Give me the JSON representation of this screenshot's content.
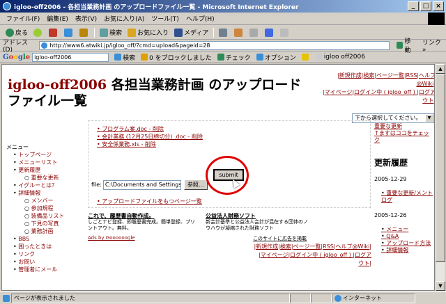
{
  "window": {
    "title": "igloo-off2006 - 各担当業務計画 のアップロードファイル一覧 - Microsoft Internet Explorer",
    "minimize": "_",
    "maximize": "□",
    "close": "×"
  },
  "menubar": {
    "items": [
      "ファイル(F)",
      "編集(E)",
      "表示(V)",
      "お気に入り(A)",
      "ツール(T)",
      "ヘルプ(H)"
    ]
  },
  "toolbar": {
    "back": "戻る",
    "search": "検索",
    "favorites": "お気に入り",
    "media": "メディア"
  },
  "addressbar": {
    "label": "アドレス(D)",
    "url": "http://www6.atwiki.jp/igloo_off/?cmd=upload&pageid=28",
    "go": "移動",
    "links": "リンク »"
  },
  "googlebar": {
    "logo": "Google",
    "query": "igloo-off2006",
    "search_btn": "検索",
    "blocked": "0 をブロックしました",
    "check": "チェック",
    "options": "オプション",
    "tab": "igloo off2006"
  },
  "page": {
    "brand": "igloo-off2006",
    "title_rest": " 各担当業務計画 のアップロードファイル一覧",
    "topnav_line1": "|新規作成|検索|ページ一覧|RSS|ヘルプ@Wiki|",
    "topnav_line2": "|マイページ|ログイン中 ( igloo_off ) |ログアウト|",
    "dropdown": "下から選択してください。",
    "left_menu": {
      "header": "メニュー",
      "items": [
        {
          "level": 1,
          "label": "トップページ"
        },
        {
          "level": 1,
          "label": "メニューリスト"
        },
        {
          "level": 1,
          "label": "更新履歴"
        },
        {
          "level": 2,
          "label": "重要な更新"
        },
        {
          "level": 1,
          "label": "イグルーとは？"
        },
        {
          "level": 1,
          "label": "詳細情報"
        },
        {
          "level": 2,
          "label": "メンバー"
        },
        {
          "level": 2,
          "label": "参加規程"
        },
        {
          "level": 2,
          "label": "装備品リスト"
        },
        {
          "level": 2,
          "label": "下見の写真"
        },
        {
          "level": 2,
          "label": "業務計画"
        },
        {
          "level": 1,
          "label": "BBS"
        },
        {
          "level": 1,
          "label": "困ったときは"
        },
        {
          "level": 1,
          "label": "リンク"
        },
        {
          "level": 1,
          "label": "お問い"
        },
        {
          "level": 1,
          "label": "管理者にメール"
        }
      ]
    },
    "files": [
      "プログラム案.doc - 削除",
      "会計業務 (12月25日締切分) .doc - 削除",
      "安全係業務.xls - 削除"
    ],
    "upload": {
      "label": "file:",
      "path": "C:\\Documents and Settings",
      "browse": "参照...",
      "submit": "submit"
    },
    "more_uploads": "アップロードファイルをもつページ一覧",
    "ad1": {
      "title": "これで、履歴書自動作成。",
      "body": "しごとナビ登録、即履歴書完成。簡単登録、プリントアウト。無料。"
    },
    "ad2": {
      "title": "公益法人財務ソフト",
      "body": "新会計基準と公益法人会計が混在する団体のノウハウが凝縮された財務ソフト"
    },
    "ads_by": "Ads by Goooooogle",
    "ads_note": "このサイトに広告を掲載",
    "bottomnav_line1": "|新規作成|検索|ページ一覧|RSS|ヘルプ@Wiki|",
    "bottomnav_line2": "|マイページ|ログイン中 ( igloo_off ) |ログアウト|",
    "right": {
      "important_link1": "重要な更新",
      "important_link2": "↑ますはココをチェック",
      "header": "更新履歴",
      "dates": [
        {
          "date": "2005-12-29",
          "items": [
            "重要な更新/メントログ"
          ]
        },
        {
          "date": "2005-12-26",
          "items": [
            "メニュー",
            "Q&A",
            "アップロード方法",
            "詳細情報"
          ]
        }
      ]
    }
  },
  "statusbar": {
    "text": "ページが表示されました",
    "zone": "インターネット"
  }
}
